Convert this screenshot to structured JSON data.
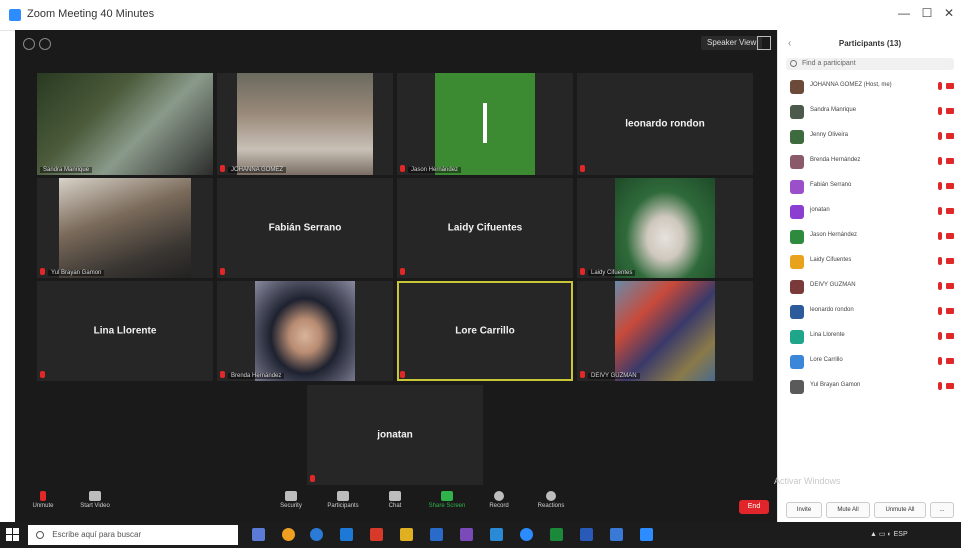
{
  "window": {
    "title": "Zoom Meeting 40 Minutes",
    "minimize": "—",
    "maximize": "☐",
    "close": "✕"
  },
  "topbar": {
    "speaker_view": "Speaker View"
  },
  "tiles": [
    {
      "label": "Sandra Manrique",
      "center": ""
    },
    {
      "label": "JOHANNA GOMEZ",
      "center": ""
    },
    {
      "label": "Jason Hernández",
      "center": ""
    },
    {
      "label": "",
      "center": "leonardo rondon"
    },
    {
      "label": "Yul Brayan Gamon",
      "center": ""
    },
    {
      "label": "",
      "center": "Fabián Serrano"
    },
    {
      "label": "",
      "center": "Laidy Cifuentes"
    },
    {
      "label": "Laidy Cifuentes",
      "center": ""
    },
    {
      "label": "",
      "center": "Lina Llorente"
    },
    {
      "label": "Brenda Hernández",
      "center": ""
    },
    {
      "label": "",
      "center": "Lore Carrillo"
    },
    {
      "label": "DEIVY GUZMAN",
      "center": ""
    },
    {
      "label": "",
      "center": "jonatan"
    }
  ],
  "controls": {
    "unmute": "Unmute",
    "start_video": "Start Video",
    "security": "Security",
    "participants": "Participants",
    "chat": "Chat",
    "share_screen": "Share Screen",
    "record": "Record",
    "reactions": "Reactions",
    "end": "End"
  },
  "panel": {
    "title": "Participants (13)",
    "search_placeholder": "Find a participant",
    "participants": [
      {
        "name": "JOHANNA GOMEZ (Host, me)",
        "color": "#6b4a3a"
      },
      {
        "name": "Sandra Manrique",
        "color": "#4b5a4a"
      },
      {
        "name": "Jenny Oliveira",
        "color": "#3d6b3d"
      },
      {
        "name": "Brenda Hernández",
        "color": "#8a5a6a"
      },
      {
        "name": "Fabián Serrano",
        "color": "#9b4fc8"
      },
      {
        "name": "jonatan",
        "color": "#8b3fd1"
      },
      {
        "name": "Jason Hernández",
        "color": "#2e8b3e"
      },
      {
        "name": "Laidy Cifuentes",
        "color": "#e8a21c"
      },
      {
        "name": "DEIVY GUZMAN",
        "color": "#7a3a3a"
      },
      {
        "name": "leonardo rondon",
        "color": "#2d5a9a"
      },
      {
        "name": "Lina Llorente",
        "color": "#1fa58a"
      },
      {
        "name": "Lore Carrillo",
        "color": "#3a86d8"
      },
      {
        "name": "Yul Brayan Gamon",
        "color": "#5a5a5a"
      }
    ],
    "watermark": "Activar Windows",
    "invite": "Invite",
    "mute_all": "Mute All",
    "unmute_all": "Unmute All",
    "more": "..."
  },
  "taskbar": {
    "search_placeholder": "Escribe aquí para buscar"
  }
}
